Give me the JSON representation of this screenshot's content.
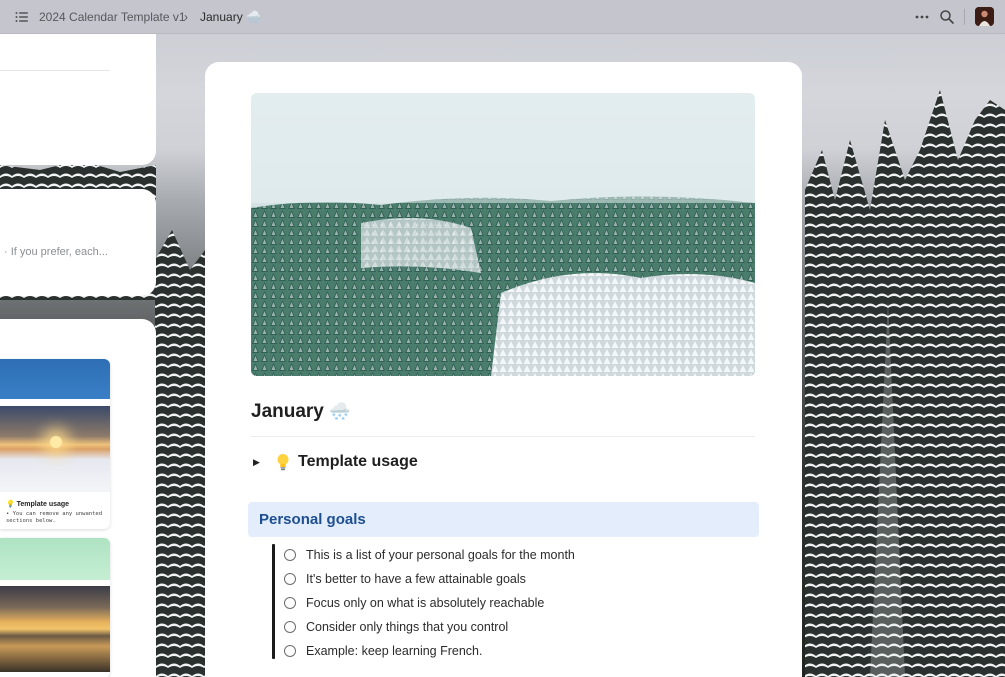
{
  "topbar": {
    "breadcrumb_parent": "2024 Calendar Template v1",
    "separator": "›",
    "breadcrumb_current": "January",
    "breadcrumb_current_emoji": "🌨️"
  },
  "sidebar_cards": {
    "card2_preview": "· If you prefer, each...",
    "thumb_a_title": "💡 Template usage",
    "thumb_a_text": "• You can remove any unwanted sections below."
  },
  "page": {
    "title": "January",
    "title_emoji": "🌨️",
    "toggle_label": "Template usage",
    "callout_title": "Personal goals",
    "goals": [
      "This is a list of your personal goals for the month",
      "It's better to have a few attainable goals",
      "Focus only on what is absolutely reachable",
      "Consider only things that you control",
      "Example: keep learning French."
    ]
  },
  "colors": {
    "callout_bg": "#e3edfb",
    "callout_text": "#1d4f91",
    "topbar_bg": "#c4c6cc"
  },
  "icons": [
    "menu-icon",
    "chevron-right-icon",
    "more-icon",
    "search-icon",
    "lightbulb-icon",
    "toggle-arrow-icon",
    "checkbox-circle-icon"
  ]
}
